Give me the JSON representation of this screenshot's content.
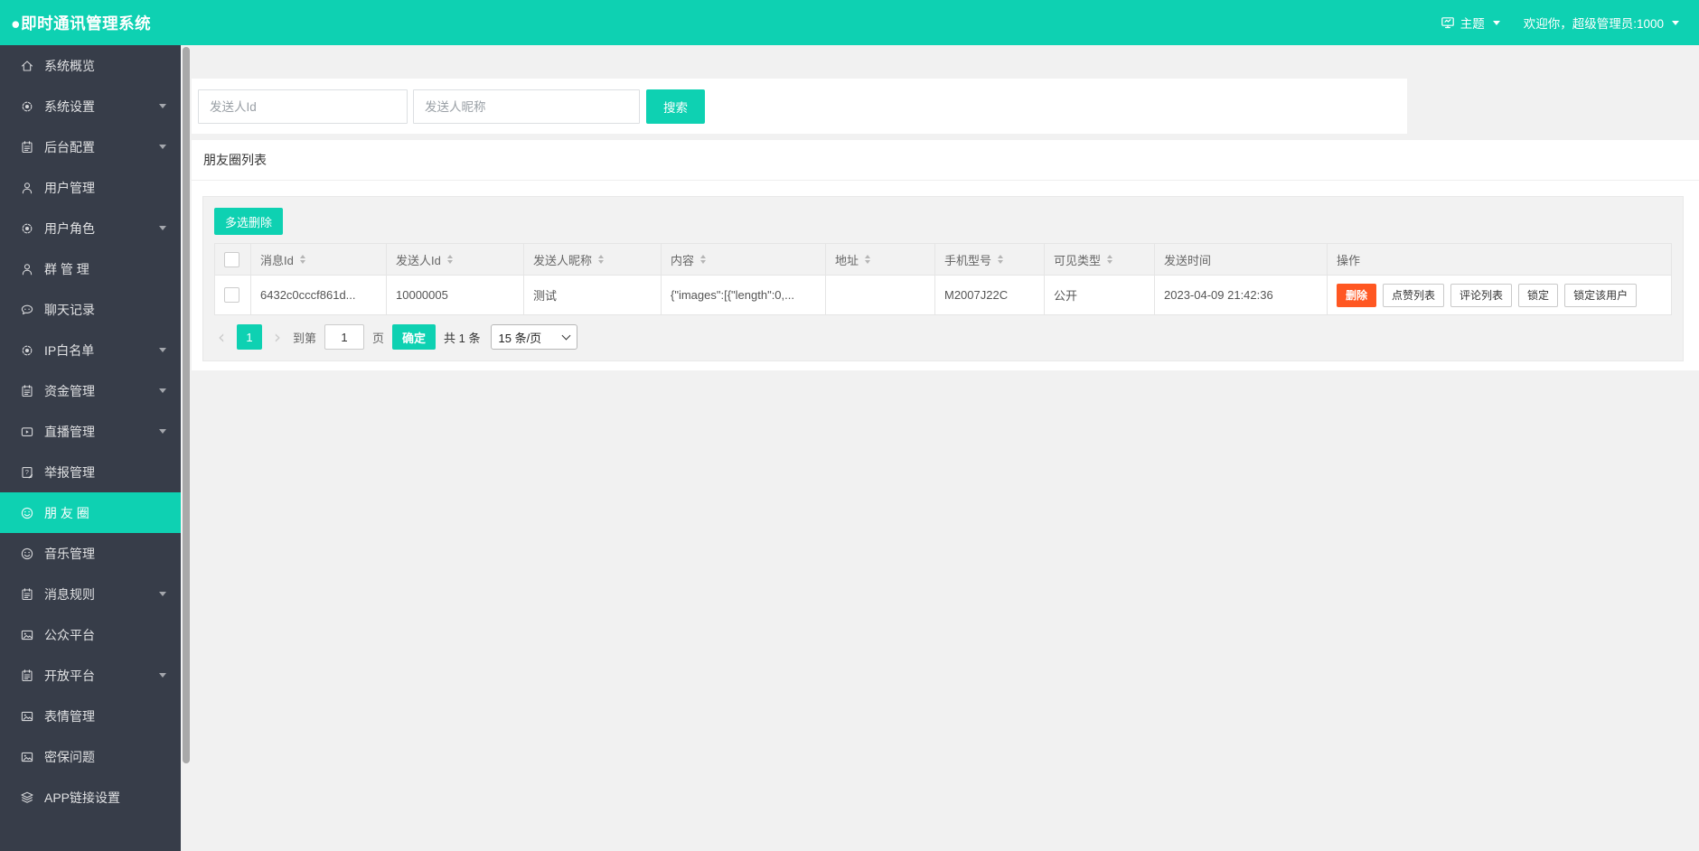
{
  "header": {
    "title": "●即时通讯管理系统",
    "theme_label": "主题",
    "welcome": "欢迎你，超级管理员:1000"
  },
  "colors": {
    "accent": "#0ed1b2",
    "sidebar_bg": "#373d49",
    "danger": "#ff5722"
  },
  "sidebar": {
    "items": [
      {
        "key": "system-overview",
        "label": "系统概览",
        "icon": "home-icon",
        "expandable": false,
        "active": false
      },
      {
        "key": "system-settings",
        "label": "系统设置",
        "icon": "gear-icon",
        "expandable": true,
        "active": false
      },
      {
        "key": "backend-config",
        "label": "后台配置",
        "icon": "notepad-icon",
        "expandable": true,
        "active": false
      },
      {
        "key": "user-management",
        "label": "用户管理",
        "icon": "user-icon",
        "expandable": false,
        "active": false
      },
      {
        "key": "user-roles",
        "label": "用户角色",
        "icon": "gear-icon",
        "expandable": true,
        "active": false
      },
      {
        "key": "group-management",
        "label": "群 管 理",
        "icon": "user-icon",
        "expandable": false,
        "active": false
      },
      {
        "key": "chat-records",
        "label": "聊天记录",
        "icon": "chat-icon",
        "expandable": false,
        "active": false
      },
      {
        "key": "ip-whitelist",
        "label": "IP白名单",
        "icon": "gear-icon",
        "expandable": true,
        "active": false
      },
      {
        "key": "funds-management",
        "label": "资金管理",
        "icon": "notepad-icon",
        "expandable": true,
        "active": false
      },
      {
        "key": "live-management",
        "label": "直播管理",
        "icon": "video-icon",
        "expandable": true,
        "active": false
      },
      {
        "key": "report-management",
        "label": "举报管理",
        "icon": "report-icon",
        "expandable": false,
        "active": false
      },
      {
        "key": "moments",
        "label": "朋 友 圈",
        "icon": "smiley-icon",
        "expandable": false,
        "active": true
      },
      {
        "key": "music-management",
        "label": "音乐管理",
        "icon": "smiley-icon",
        "expandable": false,
        "active": false
      },
      {
        "key": "message-rules",
        "label": "消息规则",
        "icon": "notepad-icon",
        "expandable": true,
        "active": false
      },
      {
        "key": "public-platform",
        "label": "公众平台",
        "icon": "image-icon",
        "expandable": false,
        "active": false
      },
      {
        "key": "open-platform",
        "label": "开放平台",
        "icon": "notepad-icon",
        "expandable": true,
        "active": false
      },
      {
        "key": "emoji-management",
        "label": "表情管理",
        "icon": "image-icon",
        "expandable": false,
        "active": false
      },
      {
        "key": "security-questions",
        "label": "密保问题",
        "icon": "image-icon",
        "expandable": false,
        "active": false
      },
      {
        "key": "app-link-settings",
        "label": "APP链接设置",
        "icon": "layers-icon",
        "expandable": false,
        "active": false
      }
    ]
  },
  "search": {
    "sender_id_placeholder": "发送人Id",
    "nickname_placeholder": "发送人昵称",
    "search_button": "搜索"
  },
  "list": {
    "title": "朋友圈列表",
    "bulk_delete_button": "多选删除",
    "columns": [
      {
        "key": "message_id",
        "label": "消息Id",
        "sortable": true
      },
      {
        "key": "sender_id",
        "label": "发送人Id",
        "sortable": true
      },
      {
        "key": "sender_nickname",
        "label": "发送人昵称",
        "sortable": true
      },
      {
        "key": "content",
        "label": "内容",
        "sortable": true
      },
      {
        "key": "address",
        "label": "地址",
        "sortable": true
      },
      {
        "key": "phone_model",
        "label": "手机型号",
        "sortable": true
      },
      {
        "key": "visibility",
        "label": "可见类型",
        "sortable": true
      },
      {
        "key": "send_time",
        "label": "发送时间",
        "sortable": false
      },
      {
        "key": "actions",
        "label": "操作",
        "sortable": false
      }
    ],
    "row": {
      "message_id": "6432c0cccf861d...",
      "sender_id": "10000005",
      "sender_nickname": "测试",
      "content": "{\"images\":[{\"length\":0,...",
      "address": "",
      "phone_model": "M2007J22C",
      "visibility": "公开",
      "send_time": "2023-04-09 21:42:36",
      "actions": [
        {
          "key": "delete",
          "label": "删除",
          "type": "danger"
        },
        {
          "key": "like-list",
          "label": "点赞列表",
          "type": "default"
        },
        {
          "key": "comment-list",
          "label": "评论列表",
          "type": "default"
        },
        {
          "key": "lock",
          "label": "锁定",
          "type": "default"
        },
        {
          "key": "lock-user",
          "label": "锁定该用户",
          "type": "default"
        }
      ]
    }
  },
  "pagination": {
    "prev": "‹",
    "next": "›",
    "current_page": "1",
    "goto_prefix": "到第",
    "goto_value": "1",
    "goto_suffix": "页",
    "confirm_button": "确定",
    "total_text": "共 1 条",
    "page_size": "15 条/页"
  }
}
